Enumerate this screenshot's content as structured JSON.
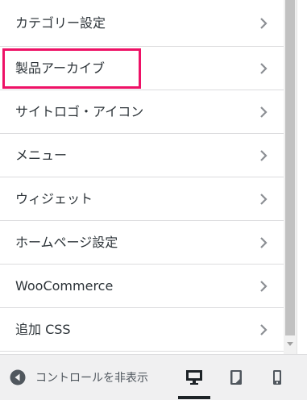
{
  "menu": {
    "items": [
      {
        "label": "カテゴリー設定"
      },
      {
        "label": "製品アーカイブ"
      },
      {
        "label": "サイトロゴ・アイコン"
      },
      {
        "label": "メニュー"
      },
      {
        "label": "ウィジェット"
      },
      {
        "label": "ホームページ設定"
      },
      {
        "label": "WooCommerce"
      },
      {
        "label": "追加 CSS"
      }
    ],
    "icon": "chevron-right-icon",
    "highlighted_item": "製品アーカイブ",
    "highlight_color": "#ee1166"
  },
  "footer": {
    "collapse_label": "コントロールを非表示",
    "collapse_icon": "arrow-left-circle-icon",
    "devices": [
      {
        "icon": "desktop-icon",
        "active": true
      },
      {
        "icon": "tablet-icon",
        "active": false
      },
      {
        "icon": "mobile-icon",
        "active": false
      }
    ]
  }
}
